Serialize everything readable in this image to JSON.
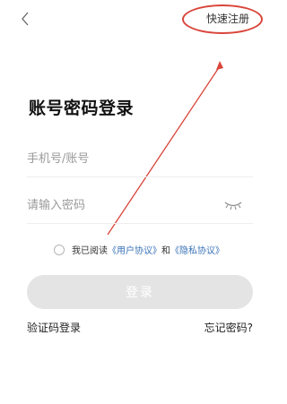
{
  "header": {
    "register_label": "快速注册"
  },
  "main": {
    "title": "账号密码登录",
    "account_placeholder": "手机号/账号",
    "password_placeholder": "请输入密码",
    "agreement": {
      "prefix": "我已阅读",
      "user_agreement": "《用户协议》",
      "conjunction": "和",
      "privacy_policy": "《隐私协议》"
    },
    "login_label": "登录"
  },
  "footer": {
    "sms_login_label": "验证码登录",
    "forgot_password_label": "忘记密码?"
  },
  "icons": {
    "back": "chevron-left-icon",
    "password_visibility": "eye-closed-icon"
  },
  "colors": {
    "annotation": "#d9453a",
    "link": "#3a73b8",
    "button_disabled": "#e4e4e4"
  }
}
